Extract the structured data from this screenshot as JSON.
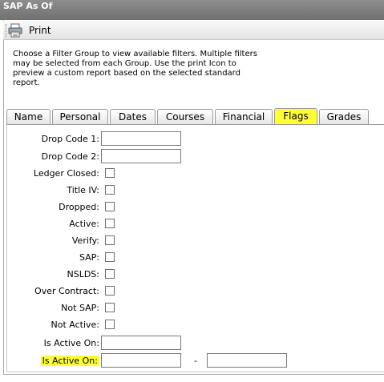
{
  "window": {
    "title": "SAP As Of"
  },
  "toolbar": {
    "print_label": "Print"
  },
  "instructions": "Choose a Filter Group to view available filters. Multiple filters may be selected from each Group. Use the print Icon to preview a custom report based on the selected standard report.",
  "tabs": [
    {
      "label": "Name"
    },
    {
      "label": "Personal"
    },
    {
      "label": "Dates"
    },
    {
      "label": "Courses"
    },
    {
      "label": "Financial"
    },
    {
      "label": "Flags",
      "active": true
    },
    {
      "label": "Grades"
    }
  ],
  "form": {
    "drop_code_1": {
      "label": "Drop Code 1:",
      "value": ""
    },
    "drop_code_2": {
      "label": "Drop Code 2:",
      "value": ""
    },
    "ledger_closed": {
      "label": "Ledger Closed:",
      "checked": false
    },
    "title_iv": {
      "label": "Title IV:",
      "checked": false
    },
    "dropped": {
      "label": "Dropped:",
      "checked": false
    },
    "active": {
      "label": "Active:",
      "checked": false
    },
    "verify": {
      "label": "Verify:",
      "checked": false
    },
    "sap": {
      "label": "SAP:",
      "checked": false
    },
    "nslds": {
      "label": "NSLDS:",
      "checked": false
    },
    "over_contract": {
      "label": "Over Contract:",
      "checked": false
    },
    "not_sap": {
      "label": "Not SAP:",
      "checked": false
    },
    "not_active": {
      "label": "Not Active:",
      "checked": false
    },
    "is_active_on_1": {
      "label": "Is Active On:",
      "value": ""
    },
    "is_active_on_2": {
      "label": "Is Active On:",
      "from": "",
      "separator": "-",
      "to": ""
    }
  },
  "colors": {
    "highlight": "#ffff33",
    "titlebar": "#7f7f7f"
  }
}
